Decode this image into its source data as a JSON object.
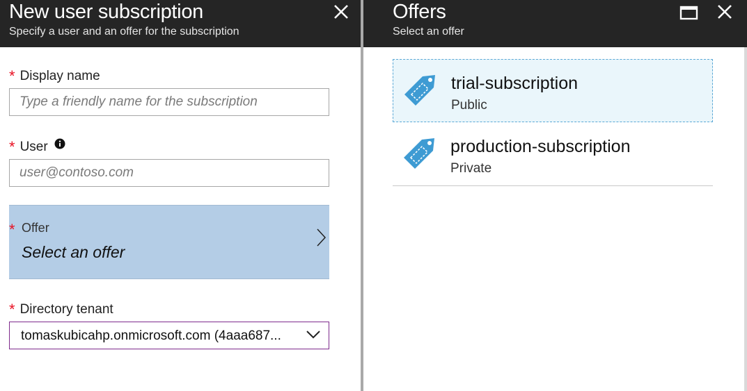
{
  "left_blade": {
    "title": "New user subscription",
    "subtitle": "Specify a user and an offer for the subscription",
    "close_icon": "close-icon",
    "fields": {
      "display_name": {
        "required_mark": "*",
        "label": "Display name",
        "placeholder": "Type a friendly name for the subscription",
        "value": ""
      },
      "user": {
        "required_mark": "*",
        "label": "User",
        "info_icon": "info-icon",
        "placeholder": "user@contoso.com",
        "value": ""
      },
      "offer": {
        "required_mark": "*",
        "label": "Offer",
        "value": "Select an offer",
        "chevron_icon": "chevron-right-icon"
      },
      "directory_tenant": {
        "required_mark": "*",
        "label": "Directory tenant",
        "value": "tomaskubicahp.onmicrosoft.com (4aaa687...",
        "chevron_icon": "chevron-down-icon"
      }
    }
  },
  "right_blade": {
    "title": "Offers",
    "subtitle": "Select an offer",
    "maximize_icon": "maximize-icon",
    "close_icon": "close-icon",
    "offers": [
      {
        "name": "trial-subscription",
        "visibility": "Public",
        "icon": "tag-icon",
        "selected": true
      },
      {
        "name": "production-subscription",
        "visibility": "Private",
        "icon": "tag-icon",
        "selected": false
      }
    ]
  },
  "colors": {
    "header_bg": "#252525",
    "required": "#e81123",
    "offer_selector_bg": "#b4cde6",
    "tenant_border": "#7e2a8c",
    "tag_icon": "#3e9bd3",
    "selected_offer_bg": "#eaf6fb"
  }
}
